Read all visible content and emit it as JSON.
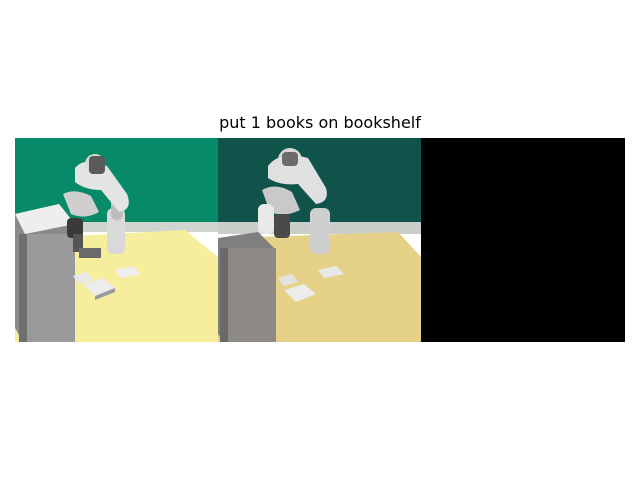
{
  "figure": {
    "title": "put 1 books on bookshelf"
  },
  "panels": [
    {
      "kind": "simulated-render",
      "wall_color": "#078a68",
      "table_color": "#f6ee9d"
    },
    {
      "kind": "generated-frame",
      "wall_color": "#10534b",
      "table_color": "#e6d188"
    },
    {
      "kind": "blank",
      "fill_color": "#000000"
    }
  ]
}
